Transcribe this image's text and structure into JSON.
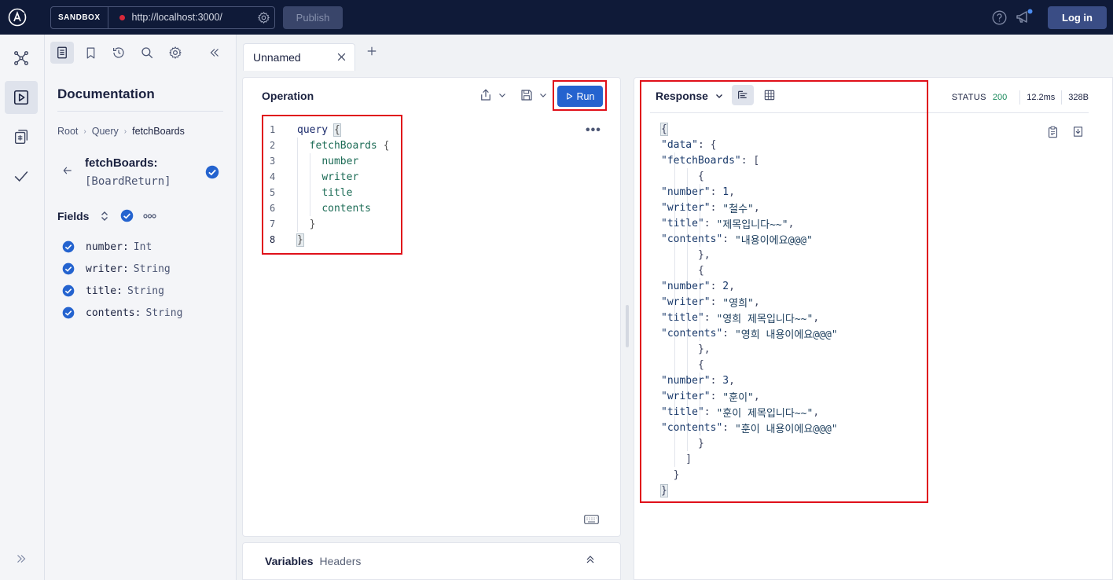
{
  "topbar": {
    "sandbox_label": "SANDBOX",
    "endpoint_url": "http://localhost:3000/",
    "publish_label": "Publish",
    "login_label": "Log in"
  },
  "docs": {
    "title": "Documentation",
    "breadcrumb": [
      "Root",
      "Query",
      "fetchBoards"
    ],
    "field_name": "fetchBoards:",
    "field_type": "[BoardReturn]",
    "fields_label": "Fields",
    "fields": [
      {
        "name": "number:",
        "type": "Int"
      },
      {
        "name": "writer:",
        "type": "String"
      },
      {
        "name": "title:",
        "type": "String"
      },
      {
        "name": "contents:",
        "type": "String"
      }
    ]
  },
  "tabs": {
    "active_label": "Unnamed"
  },
  "operation": {
    "title": "Operation",
    "run_label": "Run",
    "line_numbers": [
      "1",
      "2",
      "3",
      "4",
      "5",
      "6",
      "7",
      "8"
    ],
    "code": {
      "l1_kw": "query",
      "l1_br": "{",
      "l2_fld": "fetchBoards",
      "l2_br": "{",
      "l3": "number",
      "l4": "writer",
      "l5": "title",
      "l6": "contents",
      "l7": "}",
      "l8": "}"
    }
  },
  "variables": {
    "vars_label": "Variables",
    "headers_label": "Headers"
  },
  "response": {
    "title": "Response",
    "status_label": "STATUS",
    "status_code": "200",
    "time": "12.2ms",
    "size": "328B",
    "json": {
      "data_key": "\"data\"",
      "fetch_key": "\"fetchBoards\"",
      "k_number": "\"number\"",
      "k_writer": "\"writer\"",
      "k_title": "\"title\"",
      "k_contents": "\"contents\"",
      "items": [
        {
          "number": "1",
          "writer": "\"철수\"",
          "title": "\"제목입니다~~\"",
          "contents": "\"내용이에요@@@\""
        },
        {
          "number": "2",
          "writer": "\"영희\"",
          "title": "\"영희 제목입니다~~\"",
          "contents": "\"영희 내용이에요@@@\""
        },
        {
          "number": "3",
          "writer": "\"훈이\"",
          "title": "\"훈이 제목입니다~~\"",
          "contents": "\"훈이 내용이에요@@@\""
        }
      ]
    }
  },
  "colors": {
    "topbar_bg": "#0f1a38",
    "run_button": "#2463cf",
    "status_ok": "#1a8a5b",
    "highlight": "#e0101a"
  },
  "icons": [
    "apollo-logo-icon",
    "gear-icon",
    "help-icon",
    "megaphone-icon",
    "graph-icon",
    "play-icon",
    "schema-icon",
    "check-icon",
    "expand-icon",
    "docs-icon",
    "bookmark-icon",
    "history-icon",
    "search-icon",
    "collapse-icon",
    "arrow-left-icon",
    "check-circle-icon",
    "sort-icon",
    "more-icon",
    "close-icon",
    "plus-icon",
    "share-icon",
    "save-icon",
    "chevron-down-icon",
    "keyboard-icon",
    "chevron-up-double-icon",
    "list-view-icon",
    "table-view-icon",
    "clipboard-icon",
    "download-icon"
  ]
}
